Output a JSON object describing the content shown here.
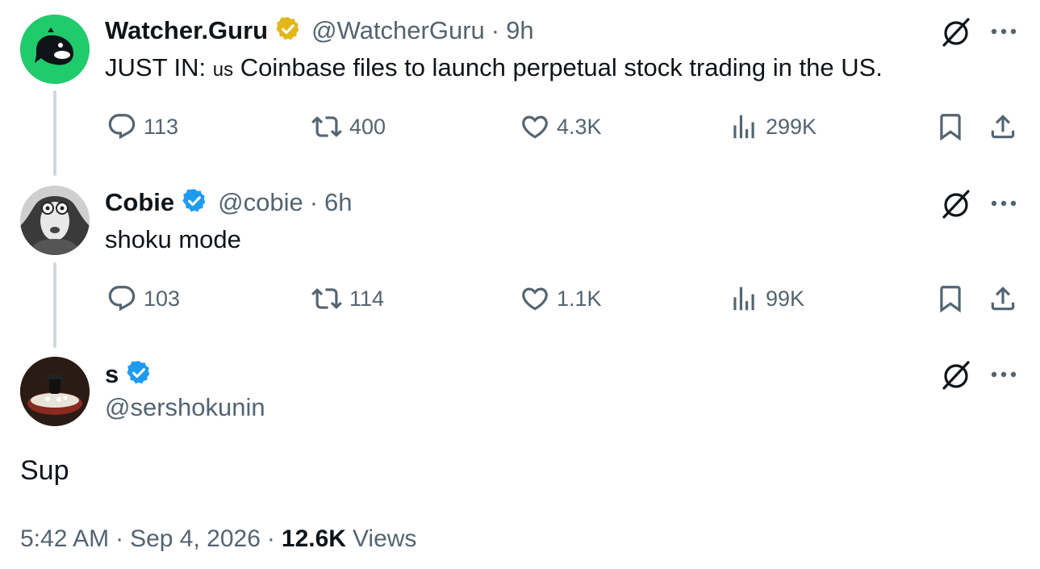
{
  "tweets": [
    {
      "name": "Watcher.Guru",
      "badge_color": "#e2b719",
      "handle": "@WatcherGuru",
      "sep": "·",
      "time": "9h",
      "text_pre": "JUST IN: ",
      "text_flag": "us",
      "text_post": " Coinbase files to launch perpetual stock trading in the US.",
      "replies": "113",
      "reposts": "400",
      "likes": "4.3K",
      "views": "299K"
    },
    {
      "name": "Cobie",
      "badge_color": "#1d9bf0",
      "handle": "@cobie",
      "sep": "·",
      "time": "6h",
      "text": "shoku mode",
      "replies": "103",
      "reposts": "114",
      "likes": "1.1K",
      "views": "99K"
    }
  ],
  "main": {
    "name": "s",
    "badge_color": "#1d9bf0",
    "handle": "@sershokunin",
    "text": "Sup",
    "time": "5:42 AM",
    "sep1": "·",
    "date": "Sep 4, 2026",
    "sep2": "·",
    "views_count": "12.6K",
    "views_label": "Views"
  },
  "icons": {
    "reply": "reply-icon",
    "repost": "repost-icon",
    "like": "heart-icon",
    "views": "views-icon",
    "bookmark": "bookmark-icon",
    "share": "share-icon",
    "grok": "grok-icon",
    "more": "more-icon"
  },
  "colors": {
    "text": "#0f1419",
    "secondary": "#536471",
    "thread_line": "#cfd9de",
    "watcher_avatar_bg": "#1fcb6b"
  }
}
